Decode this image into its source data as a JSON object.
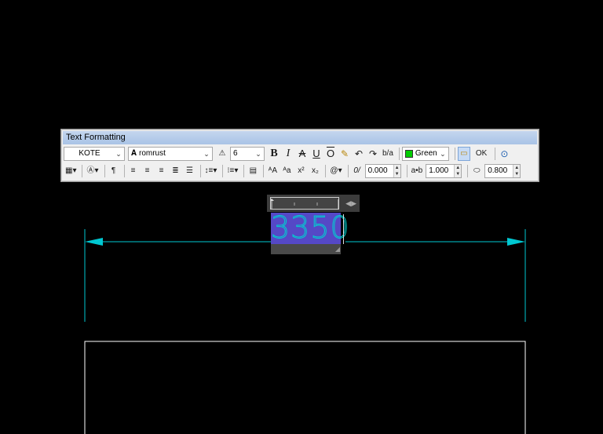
{
  "toolbar": {
    "title": "Text Formatting",
    "style": "KOTE",
    "font": "romrust",
    "text_height": "6",
    "bold": "B",
    "italic": "I",
    "strikethrough": "A",
    "underline": "U",
    "overline": "O",
    "stack": "b/a",
    "color": "Green",
    "ok": "OK",
    "oblique_angle": "0.000",
    "tracking": "1.000",
    "width_factor": "0.800",
    "symbol": "@",
    "oblique_icon": "0/",
    "tracking_icon": "a•b",
    "superscript": "x²",
    "subscript": "x₂",
    "upper": "ᴬA",
    "lower": "ᴬa"
  },
  "drawing": {
    "dimension_text": "3350",
    "colors": {
      "dimension": "#00c8d2",
      "selection": "#5548c6",
      "rectangle": "#ffffff"
    }
  }
}
